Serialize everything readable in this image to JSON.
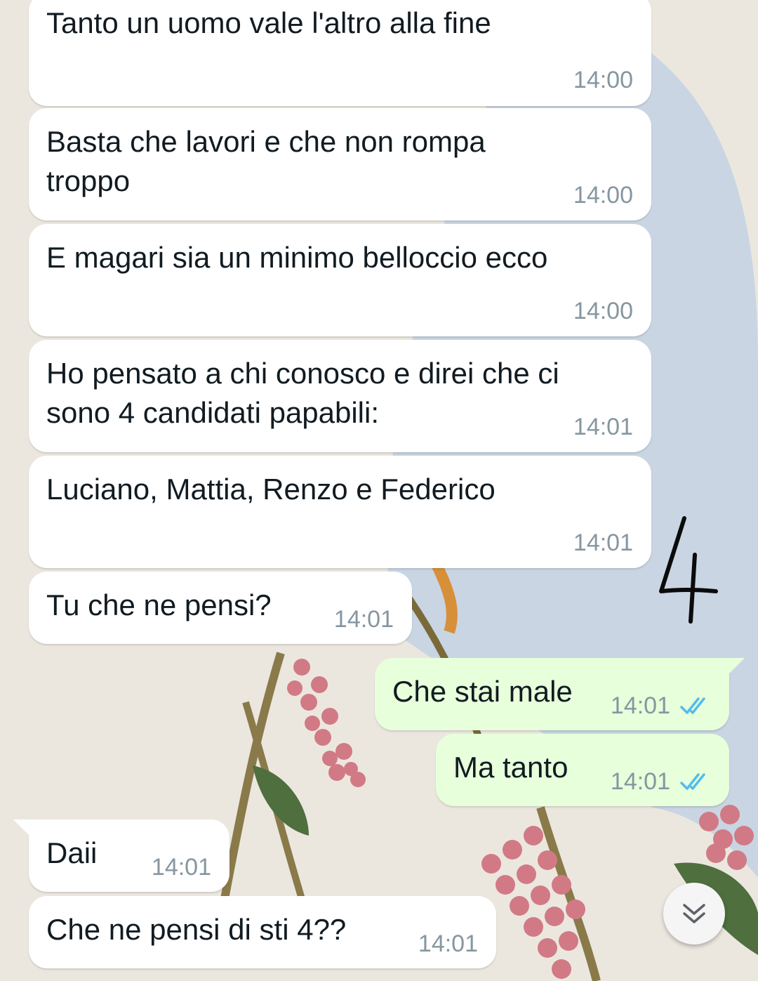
{
  "messages": [
    {
      "text": "Tanto un uomo vale l'altro alla fine",
      "time": "14:00"
    },
    {
      "text": "Basta che lavori e che non rompa\ntroppo",
      "time": "14:00"
    },
    {
      "text": "E magari sia un minimo belloccio ecco",
      "time": "14:00"
    },
    {
      "text": "Ho pensato a chi conosco e direi che ci\nsono 4 candidati papabili:",
      "time": "14:01"
    },
    {
      "text": "Luciano, Mattia, Renzo e Federico",
      "time": "14:01"
    },
    {
      "text": "Tu che ne pensi?",
      "time": "14:01"
    },
    {
      "text": "Che stai male",
      "time": "14:01",
      "status": "read"
    },
    {
      "text": "Ma tanto",
      "time": "14:01",
      "status": "read"
    },
    {
      "text": "Daii",
      "time": "14:01"
    },
    {
      "text": "Che ne pensi di sti 4??",
      "time": "14:01"
    }
  ],
  "annotation": {
    "text": "4"
  },
  "scroll_button": {
    "icon": "double-chevron-down-icon"
  },
  "colors": {
    "incoming_bubble": "#ffffff",
    "outgoing_bubble": "#e7ffdb",
    "timestamp": "#8696a0",
    "read_ticks": "#53bdeb"
  }
}
